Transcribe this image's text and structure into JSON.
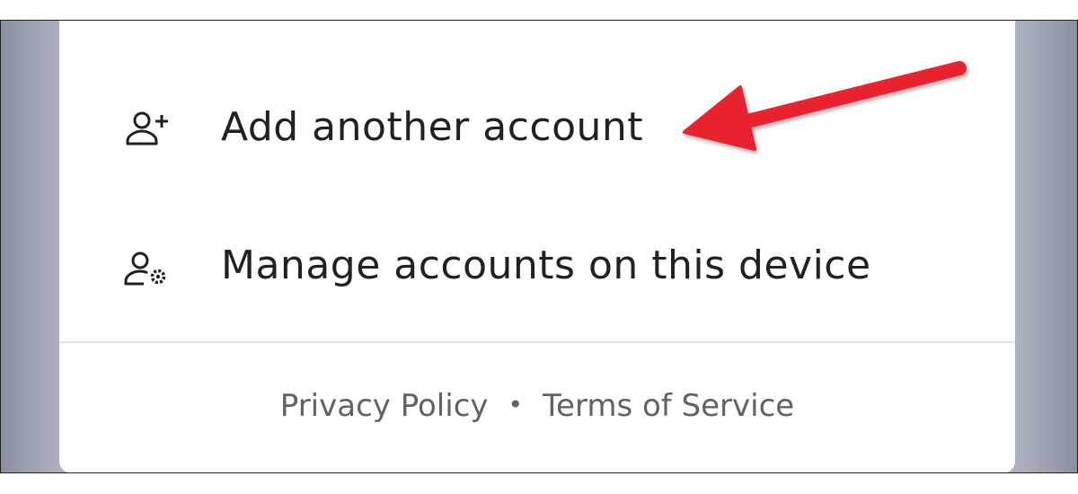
{
  "menu": {
    "items": [
      {
        "label": "Add another account",
        "icon": "person-add-icon"
      },
      {
        "label": "Manage accounts on this device",
        "icon": "manage-accounts-icon"
      }
    ]
  },
  "footer": {
    "privacy_label": "Privacy Policy",
    "separator": "•",
    "terms_label": "Terms of Service"
  },
  "annotation": {
    "arrow_color": "#e8232f",
    "arrow_target": "Add another account"
  },
  "colors": {
    "text_primary": "#202124",
    "text_secondary": "#5f6368",
    "sheet_background": "#ffffff",
    "backdrop": "#b4b7c3"
  }
}
